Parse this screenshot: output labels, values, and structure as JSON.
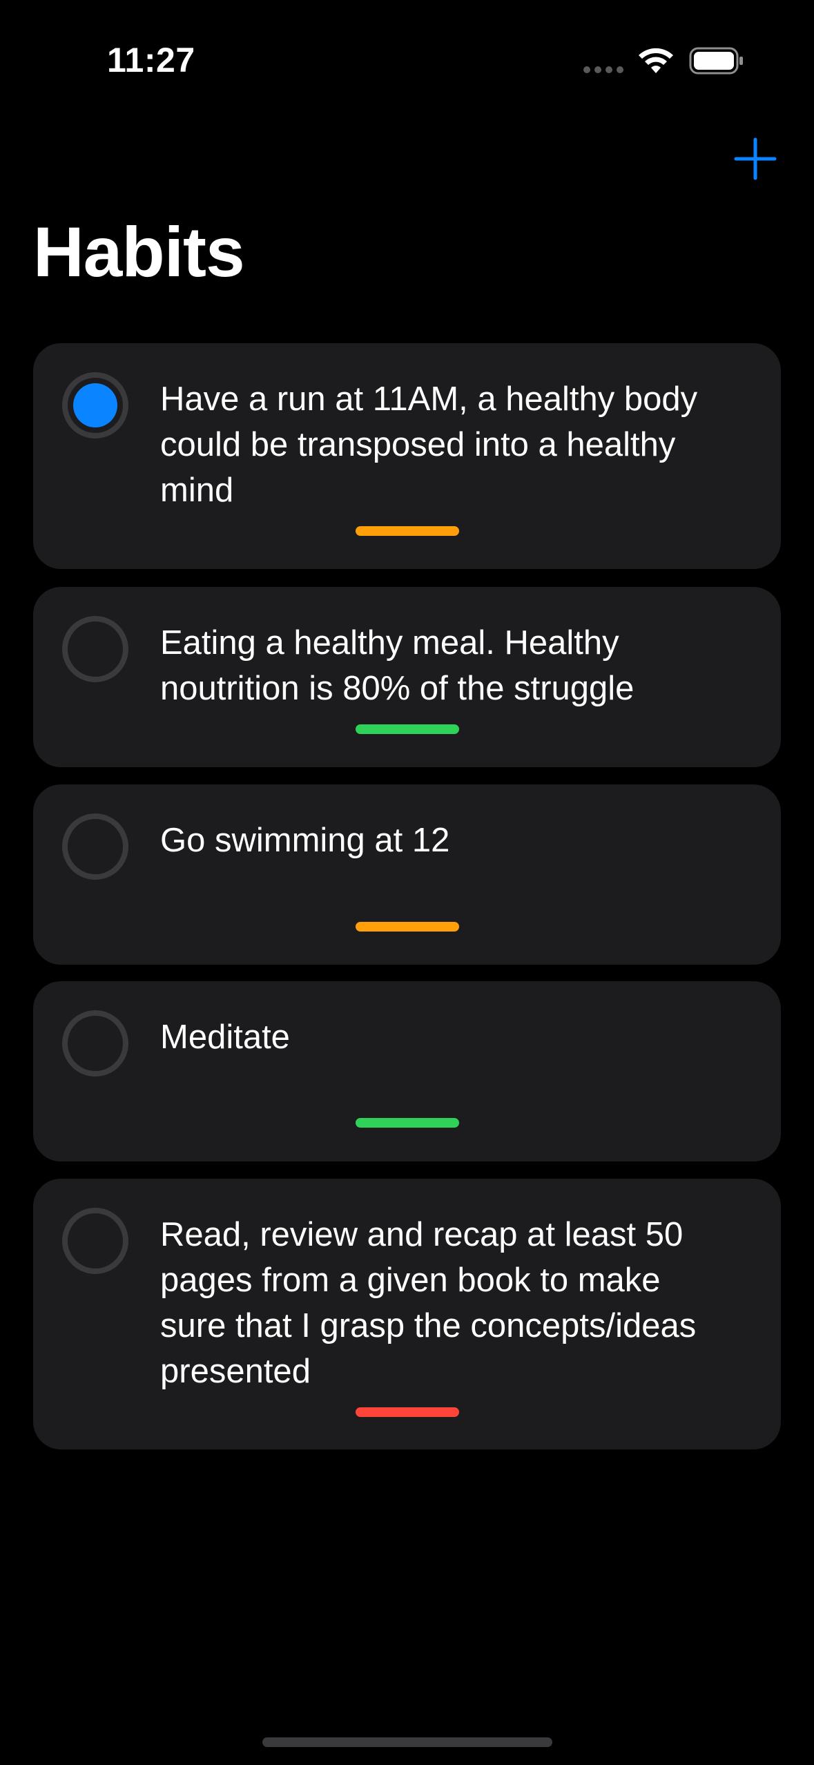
{
  "status_bar": {
    "time": "11:27",
    "icons": [
      "cellular-signal-icon",
      "wifi-icon",
      "battery-icon"
    ]
  },
  "toolbar": {
    "add_icon": "plus-icon",
    "accent_color": "#0a84ff"
  },
  "page": {
    "title": "Habits"
  },
  "habits": [
    {
      "text": "Have a run at 11AM, a healthy body could be transposed into a healthy mind",
      "selected": true,
      "priority_color": "#ff9f0a"
    },
    {
      "text": "Eating a healthy meal. Healthy noutrition is 80% of the struggle",
      "selected": false,
      "priority_color": "#30d158"
    },
    {
      "text": "Go swimming at 12",
      "selected": false,
      "priority_color": "#ff9f0a"
    },
    {
      "text": "Meditate",
      "selected": false,
      "priority_color": "#30d158"
    },
    {
      "text": "Read, review and recap at least 50 pages from a given book to make sure that I grasp the concepts/ideas presented",
      "selected": false,
      "priority_color": "#ff453a"
    }
  ],
  "colors": {
    "background": "#000000",
    "card": "#1c1c1e",
    "check_ring": "#3a3a3c",
    "check_fill": "#0a84ff"
  }
}
